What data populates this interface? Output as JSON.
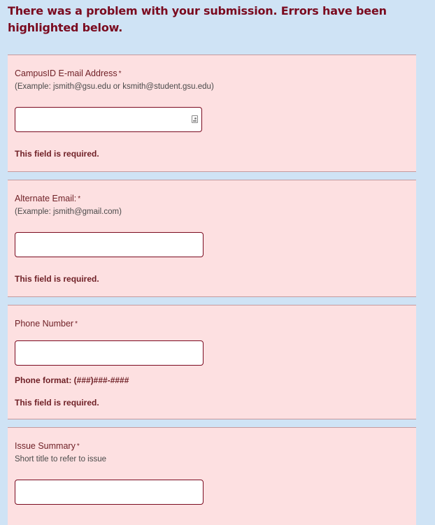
{
  "banner": {
    "message": "There was a problem with your submission. Errors have been highlighted below."
  },
  "fields": {
    "campus_email": {
      "label": "CampusID E-mail Address",
      "required_mark": "*",
      "description": "(Example: jsmith@gsu.edu or ksmith@student.gsu.edu)",
      "value": "",
      "icon": "contact-card-icon",
      "error": "This field is required."
    },
    "alternate_email": {
      "label": "Alternate Email:",
      "required_mark": "*",
      "description": "(Example: jsmith@gmail.com)",
      "value": "",
      "error": "This field is required."
    },
    "phone": {
      "label": "Phone Number",
      "required_mark": "*",
      "format_hint": "Phone format: (###)###-####",
      "value": "",
      "error": "This field is required."
    },
    "issue_summary": {
      "label": "Issue Summary",
      "required_mark": "*",
      "description": "Short title to refer to issue",
      "value": ""
    }
  },
  "colors": {
    "page_background": "#cfe3f5",
    "error_section_background": "#fde0e1",
    "error_text": "#7a0a1f",
    "input_border": "#7a0a1f"
  }
}
